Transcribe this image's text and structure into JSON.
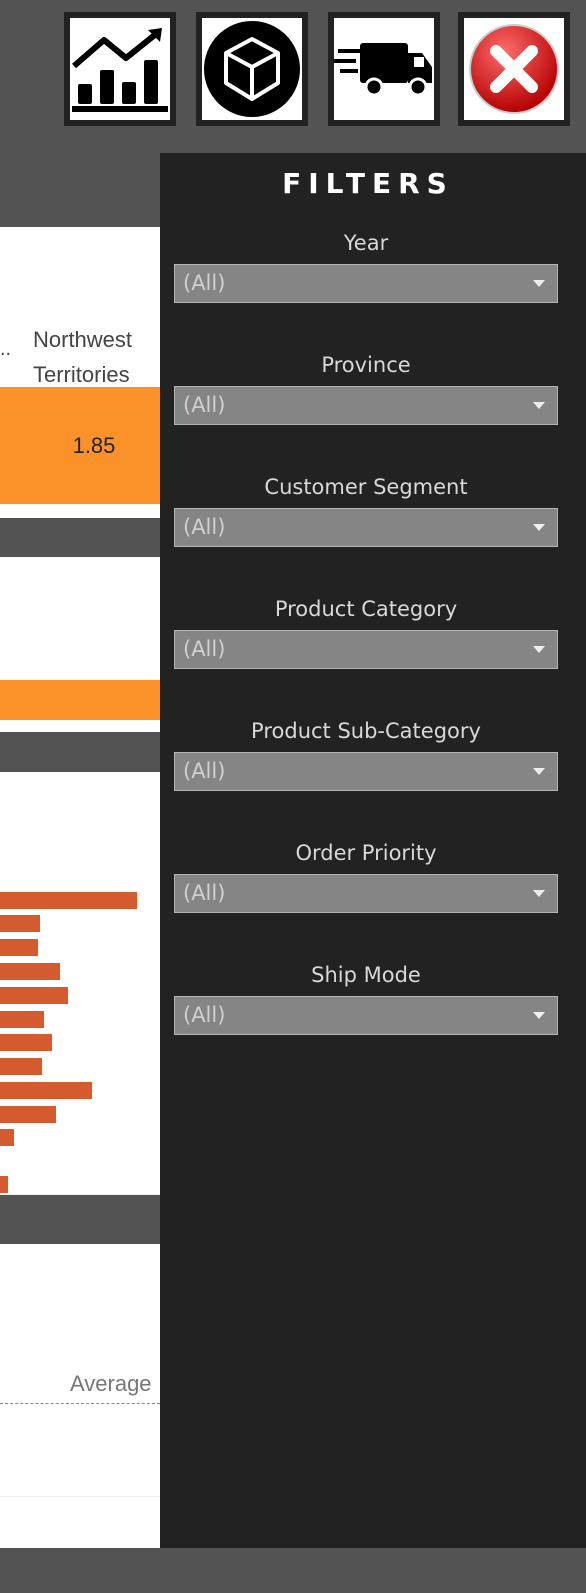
{
  "nav": {
    "buttons": [
      {
        "name": "sales-chart-icon"
      },
      {
        "name": "product-box-icon"
      },
      {
        "name": "shipping-truck-icon"
      },
      {
        "name": "close-icon"
      }
    ]
  },
  "background": {
    "region_label": "Northwest\nTerritories",
    "ellipsis": "..",
    "metric_value": "1.85",
    "average_label": "Average"
  },
  "filters": {
    "title": "FILTERS",
    "items": [
      {
        "label": "Year",
        "value": "(All)"
      },
      {
        "label": "Province",
        "value": "(All)"
      },
      {
        "label": "Customer Segment",
        "value": "(All)"
      },
      {
        "label": "Product Category",
        "value": "(All)"
      },
      {
        "label": "Product Sub-Category",
        "value": "(All)"
      },
      {
        "label": "Order Priority",
        "value": "(All)"
      },
      {
        "label": "Ship Mode",
        "value": "(All)"
      }
    ]
  },
  "colors": {
    "orange": "#fb9229",
    "bar": "#d35b2f",
    "panel": "#222222",
    "chrome": "#535353"
  }
}
